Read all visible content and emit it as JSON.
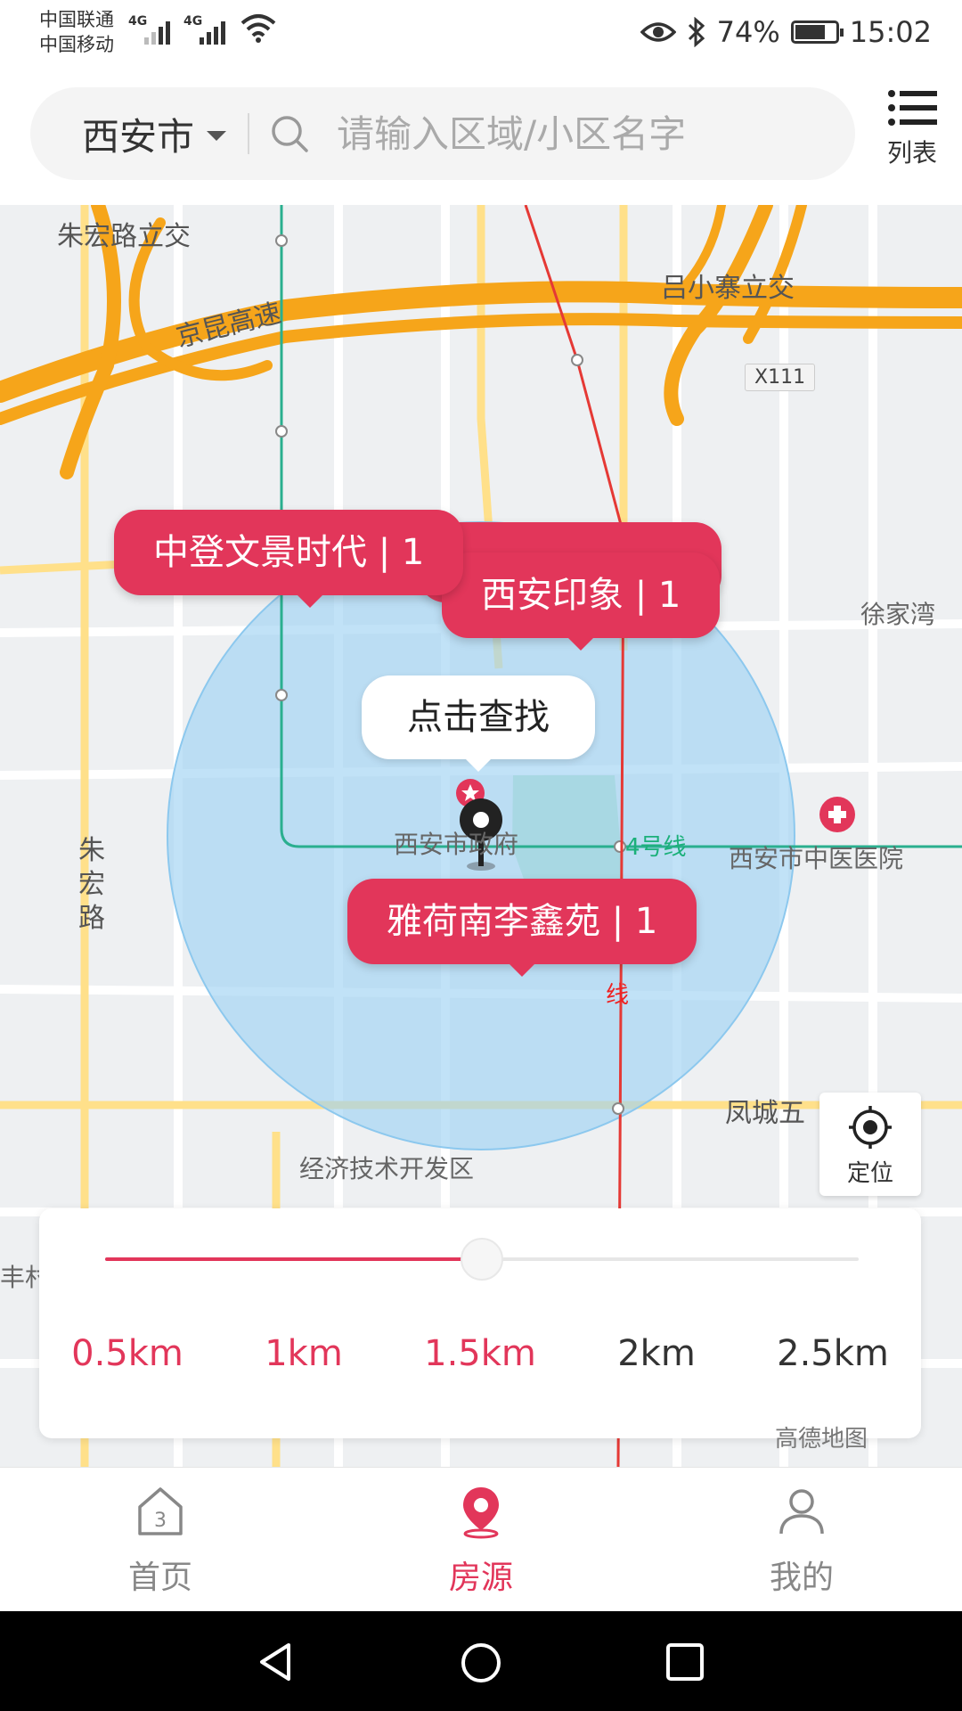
{
  "status_bar": {
    "carrier_1": "中国联通",
    "carrier_2": "中国移动",
    "network_1": "4G",
    "network_2": "4G",
    "battery": "74%",
    "time": "15:02"
  },
  "search": {
    "city": "西安市",
    "placeholder": "请输入区域/小区名字",
    "list_label": "列表"
  },
  "map": {
    "labels": {
      "zhuhong_interchange": "朱宏路立交",
      "jingkun_expressway": "京昆高速",
      "lvxiaozhai_interchange": "吕小寨立交",
      "road_x111": "X111",
      "xujiawan": "徐家湾",
      "city_gov": "西安市政府",
      "metro_line4": "4号线",
      "tcm_hospital": "西安市中医医院",
      "zhuhong_road": "朱宏路",
      "line_char": "线",
      "fengcheng": "凤城五",
      "econ_zone": "经济技术开发区",
      "village": "丰村"
    },
    "bubbles": [
      {
        "name": "中登文景时代",
        "count": "中登文景时代 | 1"
      },
      {
        "name": "西安印象",
        "count": "西安印象 | 1"
      },
      {
        "name": "雅荷南李鑫苑",
        "count": "雅荷南李鑫苑 | 1"
      }
    ],
    "click_tip": "点击查找",
    "locate_label": "定位",
    "amap_logo": "高德地图"
  },
  "radius": {
    "options": [
      "0.5km",
      "1km",
      "1.5km",
      "2km",
      "2.5km"
    ],
    "selected_index": 2,
    "selected_value": "1.5km",
    "accent": "#e2365a"
  },
  "tabbar": {
    "items": [
      {
        "label": "首页",
        "icon": "home-icon",
        "active": false
      },
      {
        "label": "房源",
        "icon": "location-pin-icon",
        "active": true
      },
      {
        "label": "我的",
        "icon": "user-icon",
        "active": false
      }
    ]
  },
  "colors": {
    "accent": "#e2365a",
    "circle": "#9fd3f3",
    "highway": "#f6a51a"
  }
}
